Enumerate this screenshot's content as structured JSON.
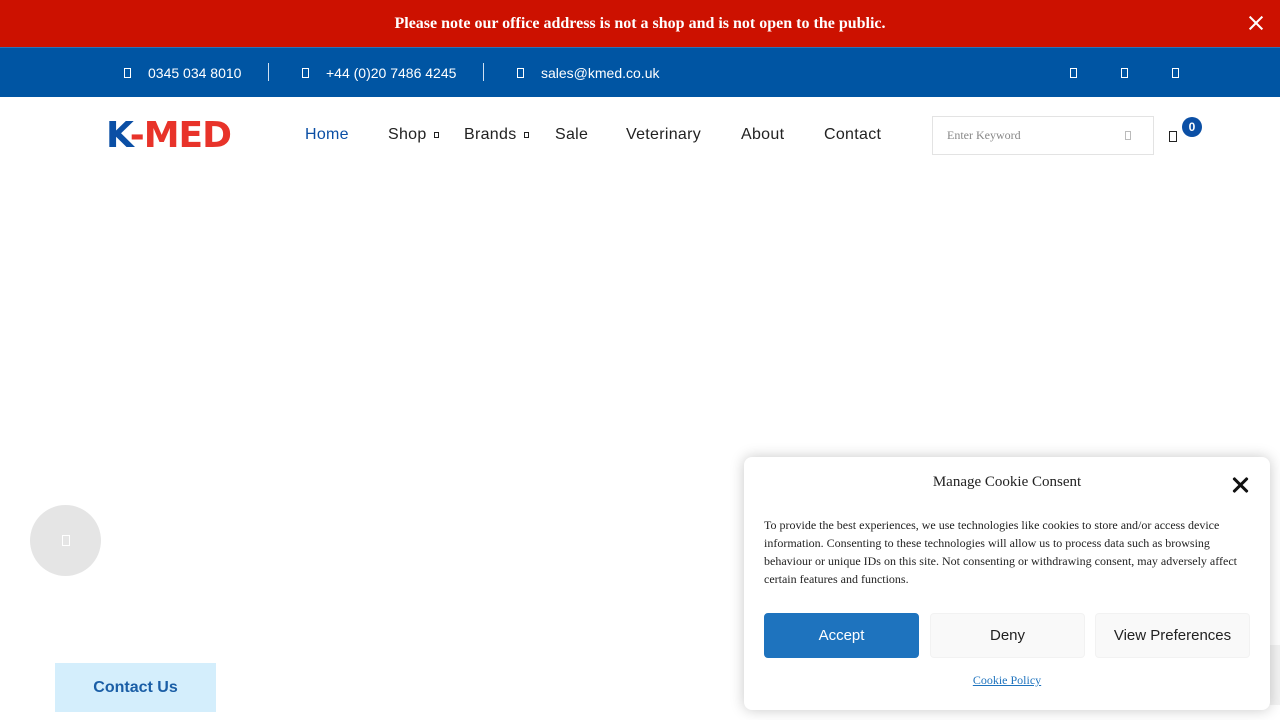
{
  "notice": {
    "text": "Please note our office address is not a shop and is not open to the public.",
    "close_icon": "close-icon"
  },
  "contact_bar": {
    "phone_1": "0345 034 8010",
    "phone_2": "+44 (0)20 7486 4245",
    "email": "sales@kmed.co.uk",
    "icons": [
      "phone-icon",
      "phone-icon",
      "mail-icon",
      "social-icon",
      "social-icon",
      "social-icon"
    ]
  },
  "header": {
    "logo_k": "K",
    "logo_rest": "-MED",
    "nav": [
      {
        "label": "Home",
        "active": true
      },
      {
        "label": "Shop",
        "has_dropdown": true
      },
      {
        "label": "Brands",
        "has_dropdown": true
      },
      {
        "label": "Sale"
      },
      {
        "label": "Veterinary"
      },
      {
        "label": "About"
      },
      {
        "label": "Contact"
      }
    ],
    "search_placeholder": "Enter Keyword",
    "cart_count": "0"
  },
  "floating": {
    "contact_us": "Contact Us"
  },
  "cookie": {
    "title": "Manage Cookie Consent",
    "text": "To provide the best experiences, we use technologies like cookies to store and/or access device information. Consenting to these technologies will allow us to process data such as browsing behaviour or unique IDs on this site. Not consenting or withdrawing consent, may adversely affect certain features and functions.",
    "accept": "Accept",
    "deny": "Deny",
    "view_preferences": "View Preferences",
    "policy_link": "Cookie Policy"
  },
  "colors": {
    "notice_bg": "#cc1100",
    "contact_bar_bg": "#0055a3",
    "brand_blue": "#0b4fa5",
    "brand_red": "#e8332a",
    "accept_bg": "#1e73be",
    "contact_us_bg": "#d4eefc"
  }
}
